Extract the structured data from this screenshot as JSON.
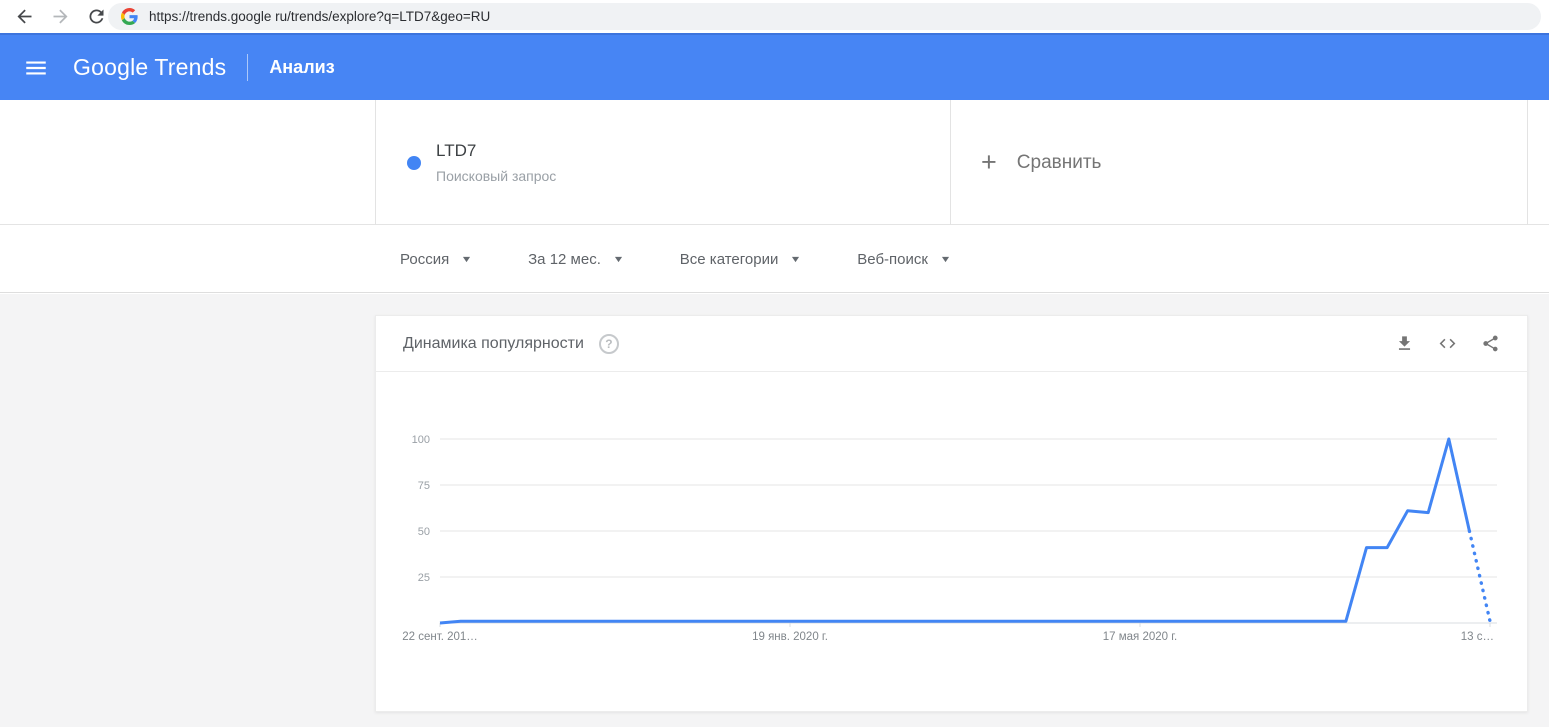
{
  "browser": {
    "url": "https://trends.google ru/trends/explore?q=LTD7&geo=RU"
  },
  "header": {
    "logo_part1": "Google",
    "logo_part2": "Trends",
    "nav_item": "Анализ"
  },
  "term_card": {
    "query": "LTD7",
    "type_label": "Поисковый запрос"
  },
  "compare": {
    "label": "Сравнить"
  },
  "filters": {
    "region": "Россия",
    "time": "За 12 мес.",
    "category": "Все категории",
    "search_type": "Веб-поиск"
  },
  "chart_card": {
    "title": "Динамика популярности"
  },
  "icons": {
    "help_glyph": "?",
    "plus_glyph": "+",
    "caret_glyph": "▼"
  },
  "colors": {
    "header_blue": "#4785f4",
    "accent_blue": "#4285f4",
    "grid_line": "#e6e6e6",
    "y_label": "#9aa0a6",
    "x_label": "#80868b",
    "content_bg": "#f4f4f5"
  },
  "chart_data": {
    "type": "line",
    "title": "Динамика популярности",
    "series": [
      {
        "name": "LTD7",
        "color": "#4285f4",
        "values": [
          0,
          1,
          1,
          1,
          1,
          1,
          1,
          1,
          1,
          1,
          1,
          1,
          1,
          1,
          1,
          1,
          1,
          1,
          1,
          1,
          1,
          1,
          1,
          1,
          1,
          1,
          1,
          1,
          1,
          1,
          1,
          1,
          1,
          1,
          1,
          1,
          1,
          1,
          1,
          1,
          1,
          1,
          1,
          1,
          1,
          41,
          41,
          61,
          60,
          100,
          50,
          1
        ]
      }
    ],
    "x_axis": {
      "points_count": 52,
      "tick_labels": [
        {
          "index": 0,
          "label": "22 сент. 201…"
        },
        {
          "index": 17,
          "label": "19 янв. 2020 г."
        },
        {
          "index": 34,
          "label": "17 мая 2020 г."
        },
        {
          "index": 51,
          "label": "13 с…"
        }
      ]
    },
    "y_axis": {
      "ticks": [
        25,
        50,
        75,
        100
      ],
      "range": [
        0,
        100
      ]
    },
    "dotted_from_index": 50,
    "grid": true,
    "legend": false
  }
}
